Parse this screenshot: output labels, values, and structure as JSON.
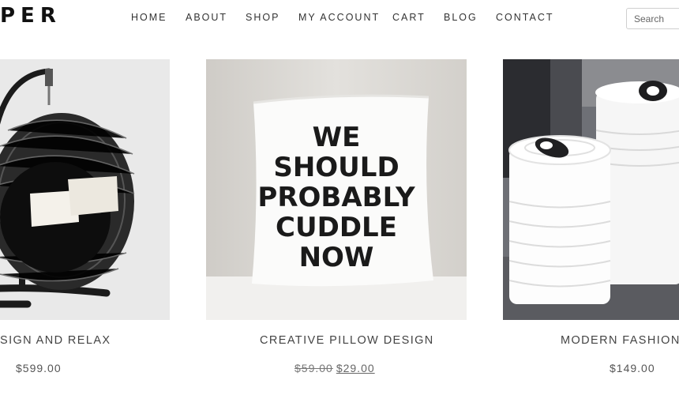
{
  "header": {
    "logo_text": "PER",
    "search_placeholder": "Search"
  },
  "nav": {
    "items": [
      {
        "label": "HOME"
      },
      {
        "label": "ABOUT"
      },
      {
        "label": "SHOP"
      },
      {
        "label": "MY ACCOUNT"
      },
      {
        "label": "CART"
      },
      {
        "label": "BLOG"
      },
      {
        "label": "CONTACT"
      }
    ]
  },
  "products": [
    {
      "title": "SIGN AND RELAX",
      "price": "$599.00",
      "image": "hanging-egg-chair"
    },
    {
      "title": "CREATIVE PILLOW DESIGN",
      "old_price": "$59.00",
      "price": "$29.00",
      "image": "pillow",
      "image_text": [
        "WE",
        "SHOULD",
        "PROBABLY",
        "CUDDLE",
        "NOW"
      ]
    },
    {
      "title": "MODERN FASHION SI",
      "price": "$149.00",
      "image": "white-canisters"
    }
  ]
}
